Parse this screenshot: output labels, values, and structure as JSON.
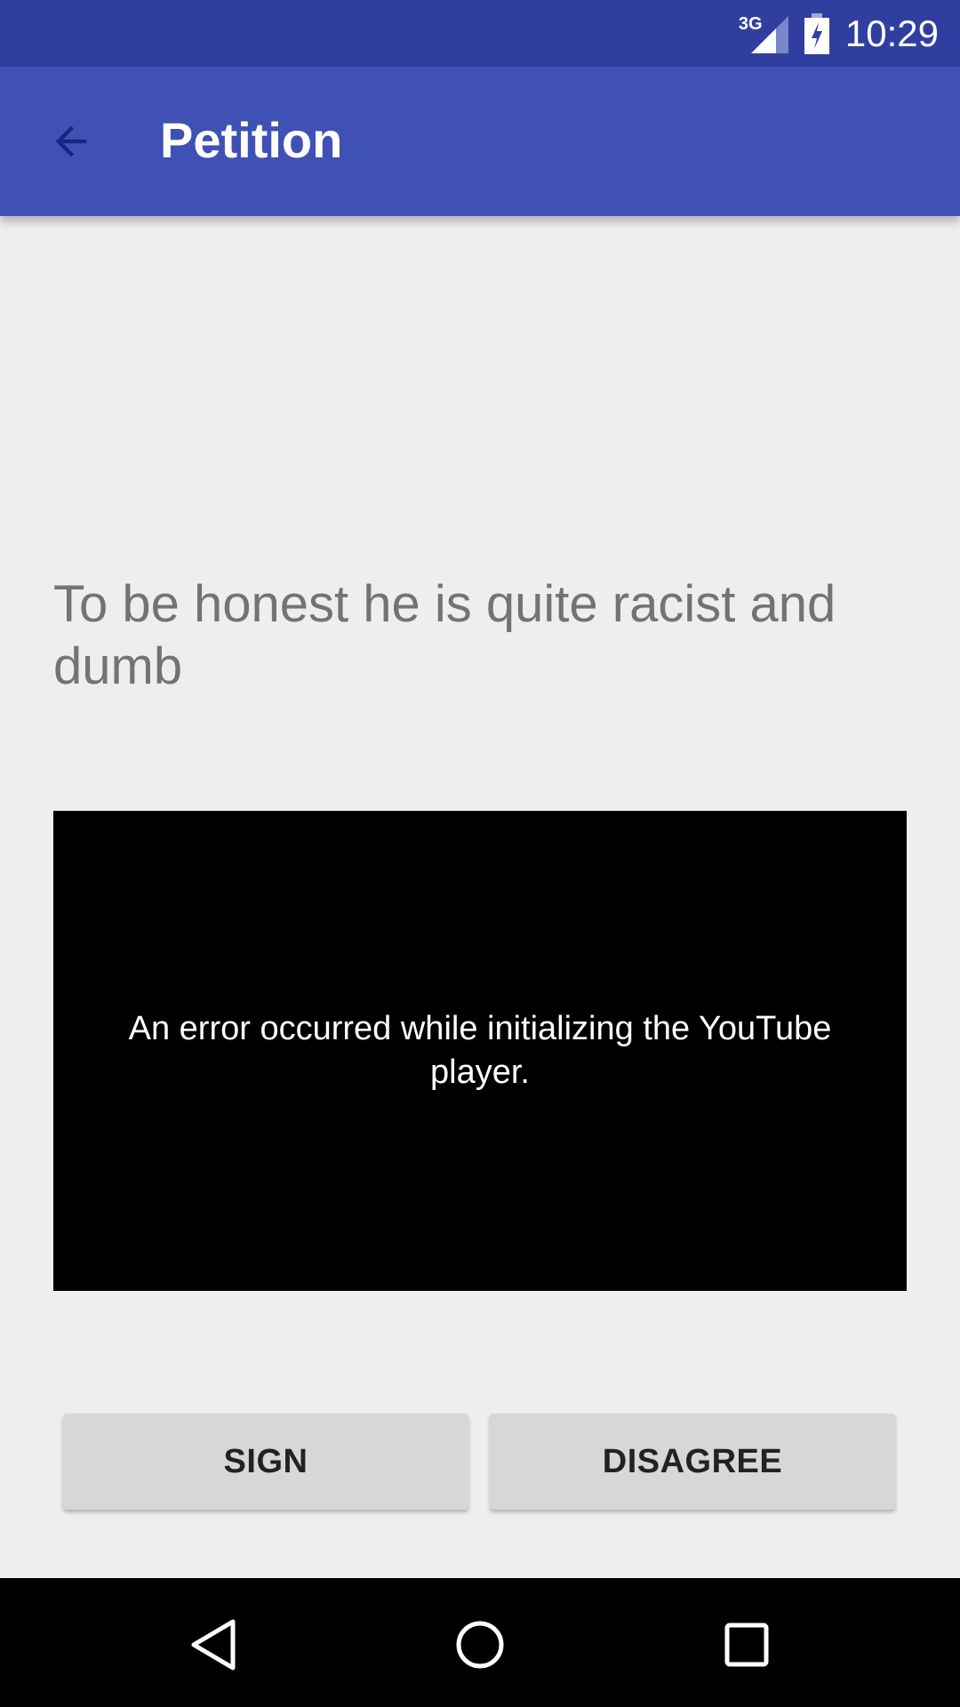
{
  "status_bar": {
    "network_type": "3G",
    "time": "10:29",
    "icons": [
      "signal-icon",
      "battery-charging-icon"
    ]
  },
  "app_bar": {
    "title": "Petition",
    "back_icon": "arrow-back-icon"
  },
  "content": {
    "petition_text": "To be honest he is quite racist and dumb",
    "video_error": "An error occurred while initializing the YouTube player."
  },
  "buttons": {
    "sign_label": "SIGN",
    "disagree_label": "DISAGREE"
  },
  "nav_bar": {
    "icons": [
      "nav-back-icon",
      "nav-home-icon",
      "nav-recents-icon"
    ]
  },
  "colors": {
    "status_bar": "#303f9f",
    "app_bar": "#3f51b5",
    "background": "#eeeeee",
    "button": "#d6d7d7"
  }
}
